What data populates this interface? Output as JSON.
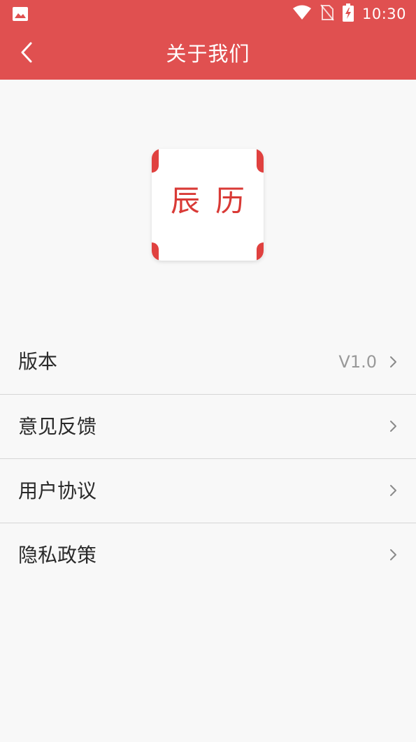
{
  "status_bar": {
    "time": "10:30",
    "icons": [
      "gallery-icon",
      "wifi-icon",
      "no-sim-icon",
      "battery-charging-icon"
    ]
  },
  "app_bar": {
    "title": "关于我们",
    "back_icon": "chevron-left-icon"
  },
  "logo": {
    "text": "辰历",
    "accent_color": "#e0413f"
  },
  "menu": [
    {
      "label": "版本",
      "value": "V1.0",
      "icon": "chevron-right-icon"
    },
    {
      "label": "意见反馈",
      "value": "",
      "icon": "chevron-right-icon"
    },
    {
      "label": "用户协议",
      "value": "",
      "icon": "chevron-right-icon"
    },
    {
      "label": "隐私政策",
      "value": "",
      "icon": "chevron-right-icon"
    }
  ],
  "colors": {
    "primary": "#e05050",
    "background": "#f8f8f8",
    "divider": "#d6d6d6",
    "text": "#2a2a2a",
    "secondary_text": "#999999"
  }
}
